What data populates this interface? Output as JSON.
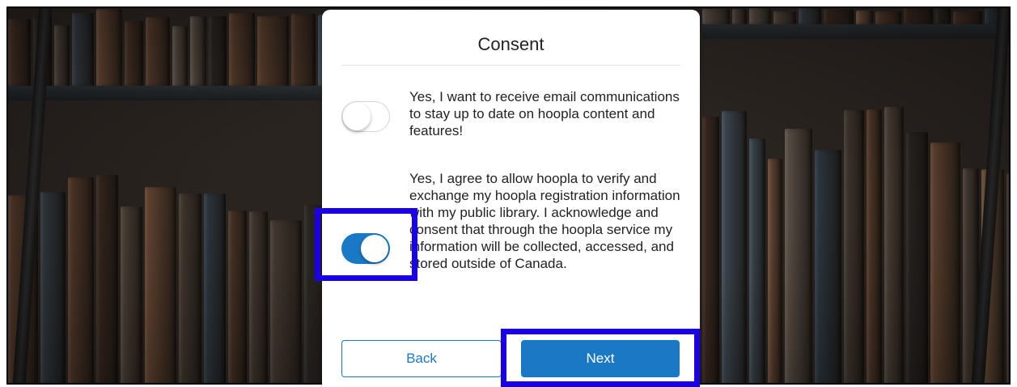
{
  "dialog": {
    "title": "Consent",
    "options": [
      {
        "text": "Yes, I want to receive email communications to stay up to date on hoopla content and features!",
        "enabled": false
      },
      {
        "text": "Yes, I agree to allow hoopla to verify and exchange my hoopla registration information with my public library.  I acknowledge and consent that through the hoopla service my information will be collected, accessed, and stored outside of Canada.",
        "enabled": true
      }
    ],
    "back_label": "Back",
    "next_label": "Next"
  },
  "colors": {
    "accent": "#1b78c4",
    "highlight": "#1a00e6"
  }
}
